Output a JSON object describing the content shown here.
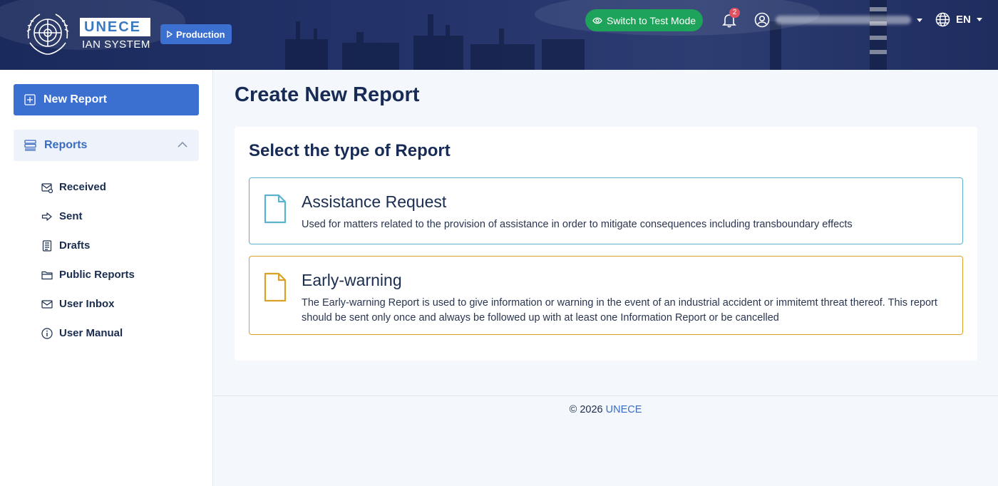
{
  "header": {
    "logo_text": "UNECE",
    "logo_subtitle": "IAN SYSTEM",
    "env_label": "Production",
    "test_mode_label": "Switch to Test Mode",
    "notification_count": "2",
    "language": "EN"
  },
  "sidebar": {
    "new_report_label": "New Report",
    "reports_label": "Reports",
    "items": [
      {
        "label": "Received",
        "icon": "received-icon"
      },
      {
        "label": "Sent",
        "icon": "sent-icon"
      },
      {
        "label": "Drafts",
        "icon": "drafts-icon"
      },
      {
        "label": "Public Reports",
        "icon": "folder-icon"
      },
      {
        "label": "User Inbox",
        "icon": "envelope-icon"
      },
      {
        "label": "User Manual",
        "icon": "info-icon"
      }
    ]
  },
  "main": {
    "page_title": "Create New Report",
    "card_title": "Select the type of Report",
    "types": [
      {
        "name": "Assistance Request",
        "description": "Used for matters related to the provision of assistance in order to mitigate consequences including transboundary effects",
        "color": "#5ab2cf"
      },
      {
        "name": "Early-warning",
        "description": "The Early-warning Report is used to give information or warning in the event of an industrial accident or immitemt threat thereof. This report should be sent only once and always be followed up with at least one Information Report or be cancelled",
        "color": "#d9a126"
      }
    ]
  },
  "footer": {
    "copyright": "© 2026",
    "link": "UNECE"
  },
  "colors": {
    "primary": "#3b6fd0",
    "success": "#1ea35a",
    "header_bg": "#1a2a5c"
  }
}
